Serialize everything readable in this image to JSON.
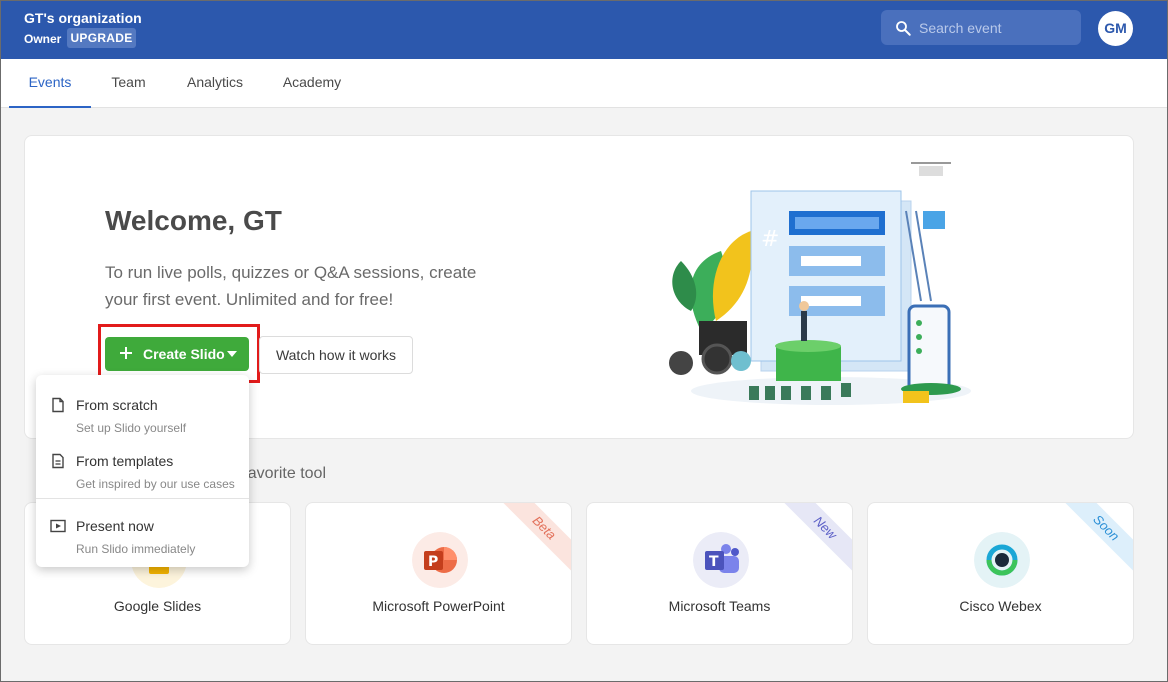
{
  "header": {
    "org_name": "GT's organization",
    "role": "Owner",
    "upgrade_label": "UPGRADE",
    "search_placeholder": "Search event",
    "avatar_initials": "GM",
    "brand_color": "#2c58ad"
  },
  "tabs": [
    {
      "label": "Events",
      "active": true
    },
    {
      "label": "Team",
      "active": false
    },
    {
      "label": "Analytics",
      "active": false
    },
    {
      "label": "Academy",
      "active": false
    }
  ],
  "welcome": {
    "title": "Welcome, GT",
    "text": "To run live polls, quizzes or Q&A sessions, create your first event. Unlimited and for free!",
    "create_label": "Create Slido",
    "watch_label": "Watch how it works",
    "accent_color": "#3faa3b"
  },
  "create_menu": {
    "items": [
      {
        "title": "From scratch",
        "subtitle": "Set up Slido yourself",
        "icon": "document-icon"
      },
      {
        "title": "From templates",
        "subtitle": "Get inspired by our use cases",
        "icon": "template-icon"
      },
      {
        "title": "Present now",
        "subtitle": "Run Slido immediately",
        "icon": "play-screen-icon"
      }
    ]
  },
  "integrations": {
    "heading_visible_part": "avorite tool",
    "cards": [
      {
        "name": "Google Slides",
        "badge": ""
      },
      {
        "name": "Microsoft PowerPoint",
        "badge": "Beta",
        "badge_color": "#e2705a"
      },
      {
        "name": "Microsoft Teams",
        "badge": "New",
        "badge_color": "#5b5fc7"
      },
      {
        "name": "Cisco Webex",
        "badge": "Soon",
        "badge_color": "#2a8fd6"
      }
    ]
  }
}
